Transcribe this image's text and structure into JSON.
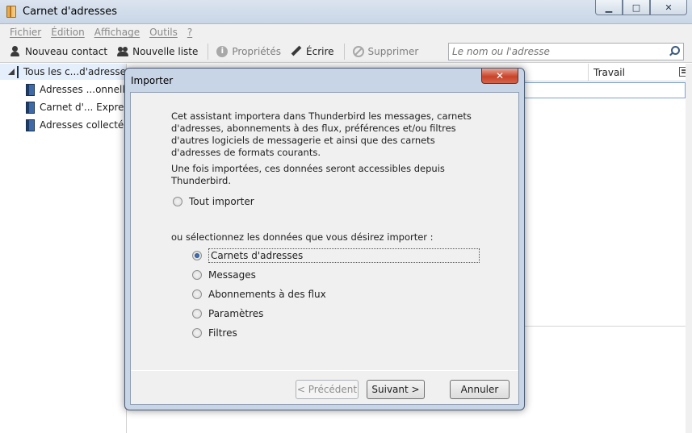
{
  "window": {
    "title": "Carnet d'adresses",
    "minimize": "▁",
    "maximize": "□",
    "close": "✕"
  },
  "menu": [
    {
      "label": "Fichier"
    },
    {
      "label": "Édition"
    },
    {
      "label": "Affichage"
    },
    {
      "label": "Outils"
    },
    {
      "label": "?"
    }
  ],
  "toolbar": {
    "new_contact": "Nouveau contact",
    "new_list": "Nouvelle liste",
    "properties": "Propriétés",
    "write": "Écrire",
    "delete": "Supprimer"
  },
  "search": {
    "placeholder": "Le nom ou l'adresse"
  },
  "tree": {
    "root": "Tous les c...d'adresses",
    "items": [
      {
        "label": "Adresses ...onnelles"
      },
      {
        "label": "Carnet d'... Express"
      },
      {
        "label": "Adresses collectées"
      }
    ]
  },
  "list": {
    "col_work": "Travail"
  },
  "dialog": {
    "title": "Importer",
    "close": "✕",
    "description": "Cet assistant importera dans Thunderbird les messages, carnets d'adresses, abonnements à des flux, préférences et/ou filtres d'autres logiciels de messagerie et ainsi que des carnets d'adresses de formats courants.",
    "description2": "Une fois importées, ces données seront accessibles depuis Thunderbird.",
    "import_all": "Tout importer",
    "select_prompt": "ou sélectionnez les données que vous désirez importer :",
    "options": [
      {
        "label": "Carnets d'adresses",
        "checked": true
      },
      {
        "label": "Messages",
        "checked": false
      },
      {
        "label": "Abonnements à des flux",
        "checked": false
      },
      {
        "label": "Paramètres",
        "checked": false
      },
      {
        "label": "Filtres",
        "checked": false
      }
    ],
    "btn_prev": "< Précédent",
    "btn_next": "Suivant >",
    "btn_cancel": "Annuler"
  }
}
